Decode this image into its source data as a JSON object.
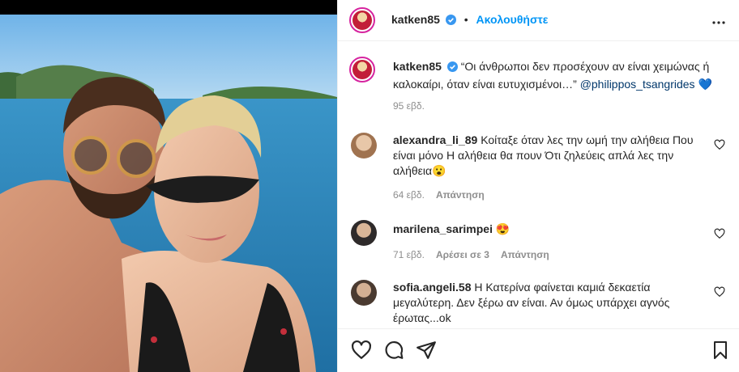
{
  "post": {
    "author": "katken85",
    "follow_label": "Ακολουθήστε",
    "dot": "•",
    "caption_text": "“Οι άνθρωποι δεν προσέχουν αν είναι χειμώνας ή καλοκαίρι, όταν είναι ευτυχισμένοι…”",
    "caption_mention": "@philippos_tsangrides",
    "caption_emoji": "💙",
    "caption_time": "95 εβδ."
  },
  "comments": [
    {
      "user": "alexandra_li_89",
      "text_line1": "Κοίταξε όταν λες την ωμή την αλήθεια Που",
      "text_line2": "είναι μόνο Η αλήθεια θα πουν Ότι ζηλεύεις απλά λες την",
      "text_line3": "αλήθεια😮",
      "time": "64 εβδ.",
      "reply": "Απάντηση"
    },
    {
      "user": "marilena_sarimpei",
      "text_line1": "😍",
      "time": "71 εβδ.",
      "likes": "Αρέσει σε 3",
      "reply": "Απάντηση"
    },
    {
      "user": "sofia.angeli.58",
      "text_line1": "Η Κατερίνα φαίνεται καμιά δεκαετία",
      "text_line2": "μεγαλύτερη. Δεν ξέρω αν είναι. Αν όμως υπάρχει αγνός",
      "text_line3": "έρωτας...ok"
    }
  ],
  "icons": {
    "like": "heart-icon",
    "comment": "comment-icon",
    "share": "share-icon",
    "save": "bookmark-icon",
    "more": "more-options-icon",
    "verified": "verified-badge-icon"
  },
  "colors": {
    "accent": "#0095f6",
    "verified": "#3897f0",
    "mention": "#00376b",
    "muted": "#8e8e8e"
  }
}
